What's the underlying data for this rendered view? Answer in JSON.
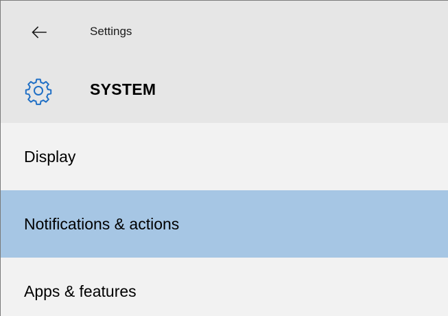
{
  "window": {
    "app_title": "Settings",
    "back_icon": "back-arrow-icon"
  },
  "section": {
    "icon": "gear-icon",
    "title": "SYSTEM",
    "accent_color": "#1f6fc5"
  },
  "nav": {
    "selected_color": "#a6c6e4",
    "items": [
      {
        "label": "Display",
        "selected": false
      },
      {
        "label": "Notifications & actions",
        "selected": true
      },
      {
        "label": "Apps & features",
        "selected": false
      }
    ]
  }
}
